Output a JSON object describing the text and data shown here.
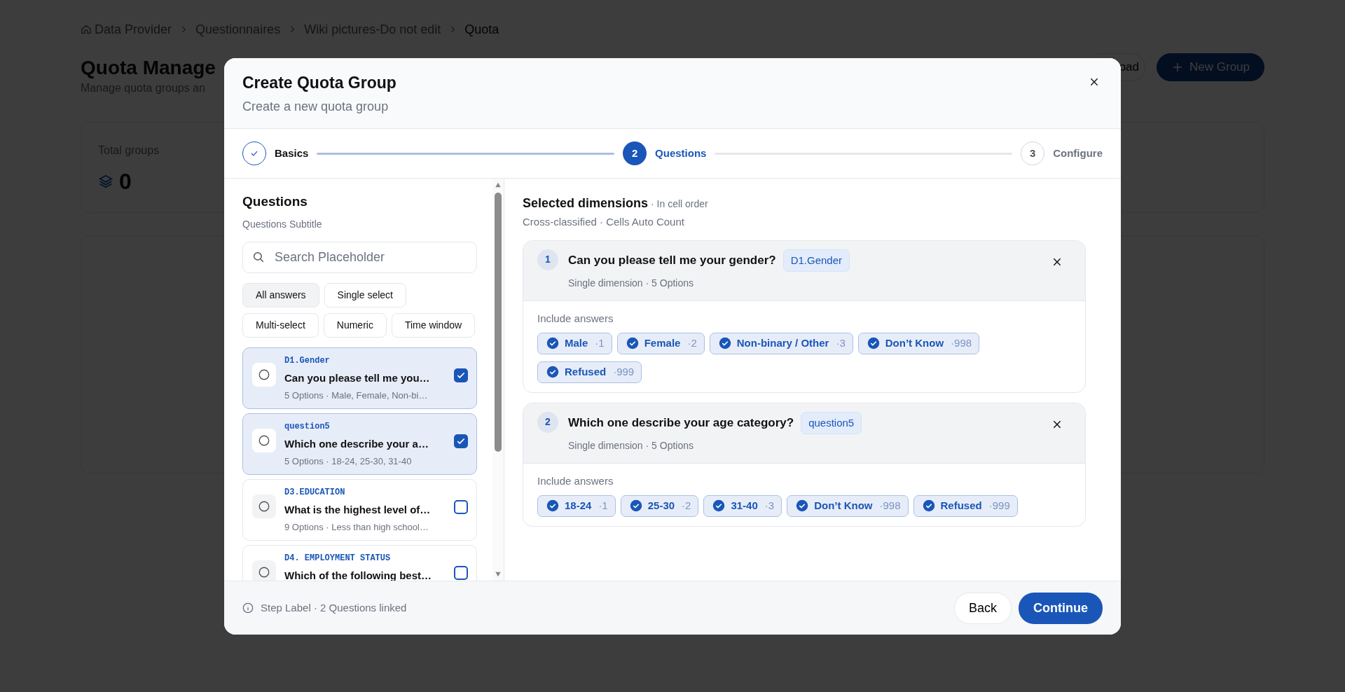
{
  "page": {
    "breadcrumb": [
      {
        "label": "Data Provider",
        "kind": "home"
      },
      {
        "label": "Questionnaires",
        "kind": "link"
      },
      {
        "label": "Wiki pictures-Do not edit",
        "kind": "link"
      },
      {
        "label": "Quota",
        "kind": "current"
      }
    ],
    "title": "Quota Manage",
    "subtitle": "Manage quota groups an",
    "buttons": [
      {
        "label": "oad",
        "kind": "outline"
      },
      {
        "label": "New Group",
        "kind": "primary"
      }
    ],
    "stat": {
      "label": "Total groups",
      "value": "0"
    }
  },
  "modal": {
    "title": "Create Quota Group",
    "subtitle": "Create a new quota group",
    "steps": [
      {
        "label": "Basics",
        "completed": true,
        "selected": false
      },
      {
        "number": "2",
        "label": "Questions",
        "completed": false,
        "selected": true
      },
      {
        "number": "3",
        "label": "Configure",
        "completed": false,
        "selected": false
      }
    ],
    "questions": {
      "title": "Questions",
      "subtitle": "Questions Subtitle",
      "search": {
        "placeholder": "Search Placeholder"
      },
      "filters": [
        {
          "label": "All answers",
          "selected": true
        },
        {
          "label": "Single select",
          "selected": false
        },
        {
          "label": "Multi-select",
          "selected": false
        },
        {
          "label": "Numeric",
          "selected": false
        },
        {
          "label": "Time window",
          "selected": false
        }
      ],
      "items": [
        {
          "code": "D1.Gender",
          "title": "Can you please tell me you…",
          "meta": "5 Options · Male, Female, Non-bi…",
          "selected": true
        },
        {
          "code": "question5",
          "title": "Which one describe your a…",
          "meta": "5 Options · 18-24, 25-30, 31-40",
          "selected": true
        },
        {
          "code": "D3.EDUCATION",
          "title": "What is the highest level of…",
          "meta": "9 Options · Less than high school…",
          "selected": false
        },
        {
          "code": "D4. EMPLOYMENT STATUS",
          "title": "Which of the following best…",
          "selected": false
        }
      ]
    },
    "dimensions": {
      "title": "Selected dimensions",
      "note": "· In cell order",
      "subtitle": "Cross-classified · Cells Auto Count",
      "items": [
        {
          "index": "1",
          "title": "Can you please tell me your gender?",
          "code": "D1.Gender",
          "meta": "Single dimension · 5 Options",
          "answers_label": "Include answers",
          "answers": [
            {
              "label": "Male",
              "code": "·1",
              "checked": true
            },
            {
              "label": "Female",
              "code": "·2",
              "checked": true
            },
            {
              "label": "Non-binary / Other",
              "code": "·3",
              "checked": true
            },
            {
              "label": "Don’t Know",
              "code": "·998",
              "checked": true
            },
            {
              "label": "Refused",
              "code": "·999",
              "checked": true
            }
          ]
        },
        {
          "index": "2",
          "title": "Which one describe your age category?",
          "code": "question5",
          "meta": "Single dimension · 5 Options",
          "answers_label": "Include answers",
          "answers": [
            {
              "label": "18-24",
              "code": "·1",
              "checked": true
            },
            {
              "label": "25-30",
              "code": "·2",
              "checked": true
            },
            {
              "label": "31-40",
              "code": "·3",
              "checked": true
            },
            {
              "label": "Don’t Know",
              "code": "·998",
              "checked": true
            },
            {
              "label": "Refused",
              "code": "·999",
              "checked": true
            }
          ]
        }
      ]
    },
    "footer": {
      "status": "Step Label · 2 Questions linked",
      "back": "Back",
      "continue": "Continue"
    }
  }
}
